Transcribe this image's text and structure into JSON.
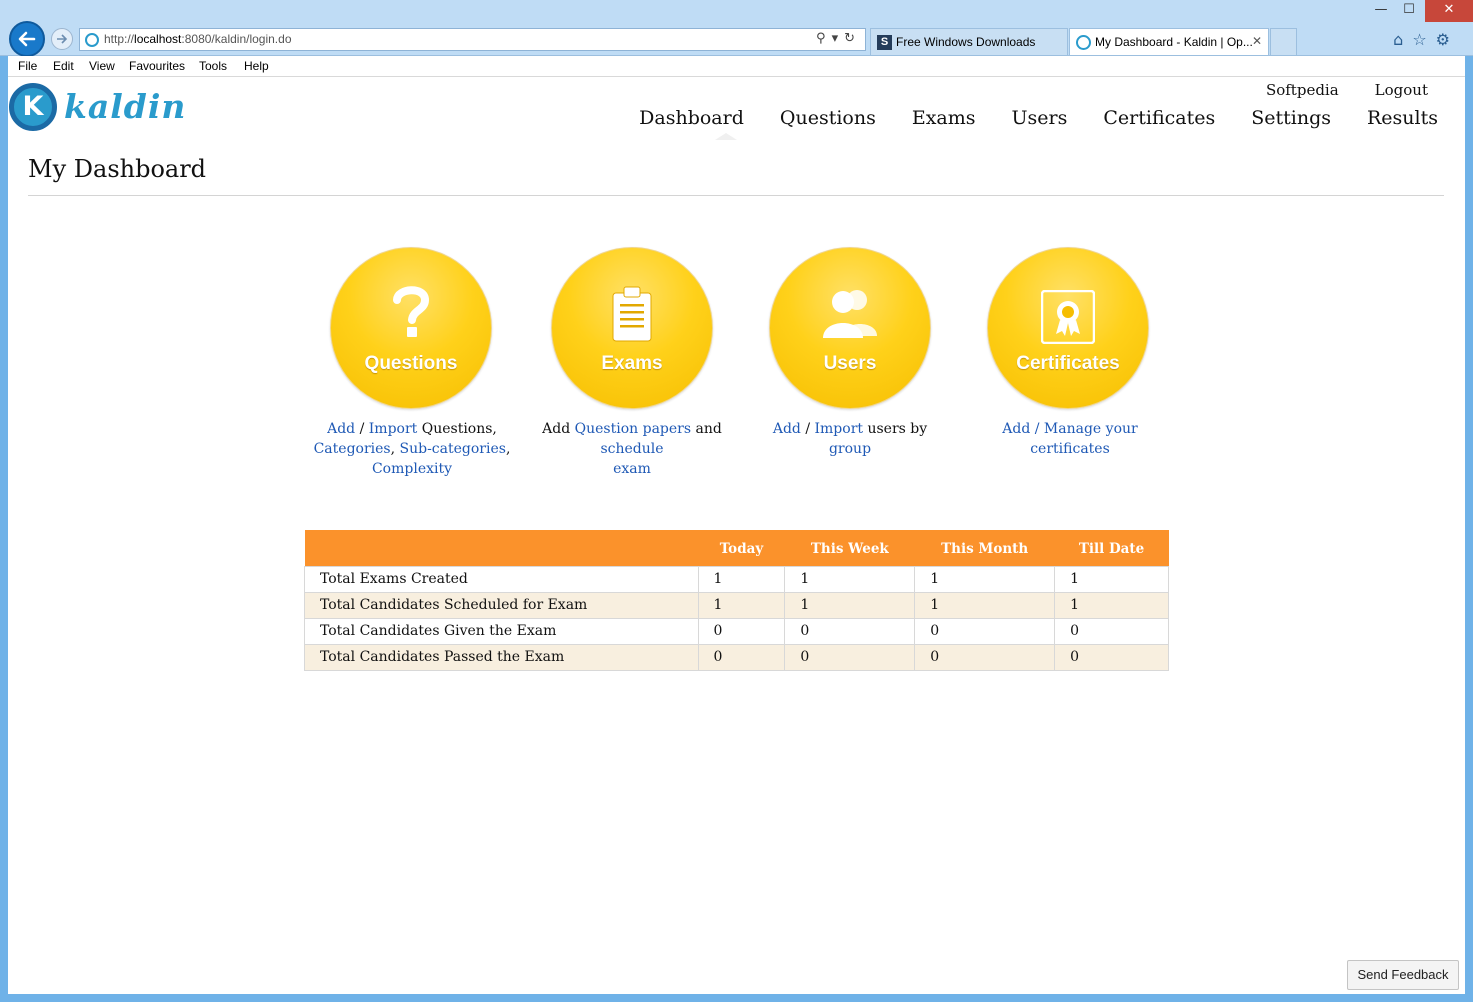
{
  "browser": {
    "url_prefix": "http://",
    "url_host": "localhost",
    "url_rest": ":8080/kaldin/login.do",
    "tabs": [
      {
        "title": "Free Windows Downloads",
        "icon": "softpedia-favicon"
      },
      {
        "title": "My Dashboard - Kaldin | Op...",
        "icon": "kaldin-favicon"
      }
    ],
    "tab_close": "✕",
    "window_controls": {
      "minimize": "—",
      "maximize": "☐",
      "close": "✕"
    },
    "menu": [
      "File",
      "Edit",
      "View",
      "Favourites",
      "Tools",
      "Help"
    ]
  },
  "logo": {
    "letter": "K",
    "text": "kaldin"
  },
  "toplinks": {
    "softpedia": "Softpedia",
    "logout": "Logout"
  },
  "nav": [
    "Dashboard",
    "Questions",
    "Exams",
    "Users",
    "Certificates",
    "Settings",
    "Results"
  ],
  "nav_active": "Dashboard",
  "page_title": "My Dashboard",
  "tiles": {
    "questions": {
      "label": "Questions",
      "icon": "question-mark-icon",
      "d_add": "Add",
      "d_sep1": " / ",
      "d_import": "Import",
      "d_q": " Questions,",
      "d_categories": "Categories",
      "d_comma1": ",",
      "d_subcat": "Sub-categories",
      "d_comma2": ",",
      "d_complexity": "Complexity"
    },
    "exams": {
      "label": "Exams",
      "icon": "clipboard-icon",
      "d_add": "Add ",
      "d_papers": "Question papers",
      "d_and": " and ",
      "d_schedule": "schedule",
      "d_exam": "exam"
    },
    "users": {
      "label": "Users",
      "icon": "users-icon",
      "d_add": "Add",
      "d_sep": " / ",
      "d_import": "Import",
      "d_by": " users by ",
      "d_group": "group"
    },
    "certificates": {
      "label": "Certificates",
      "icon": "certificate-icon",
      "d_link": "Add / Manage your certificates"
    }
  },
  "stats": {
    "columns": [
      "",
      "Today",
      "This Week",
      "This Month",
      "Till Date"
    ],
    "rows": [
      {
        "label": "Total Exams Created",
        "values": [
          "1",
          "1",
          "1",
          "1"
        ]
      },
      {
        "label": "Total Candidates Scheduled for Exam",
        "values": [
          "1",
          "1",
          "1",
          "1"
        ]
      },
      {
        "label": "Total Candidates Given the Exam",
        "values": [
          "0",
          "0",
          "0",
          "0"
        ]
      },
      {
        "label": "Total Candidates Passed the Exam",
        "values": [
          "0",
          "0",
          "0",
          "0"
        ]
      }
    ]
  },
  "feedback_label": "Send Feedback",
  "colors": {
    "accent": "#fb922b",
    "tile": "#ffd11a",
    "link": "#1f59b5",
    "brand": "#2a9bcc"
  }
}
